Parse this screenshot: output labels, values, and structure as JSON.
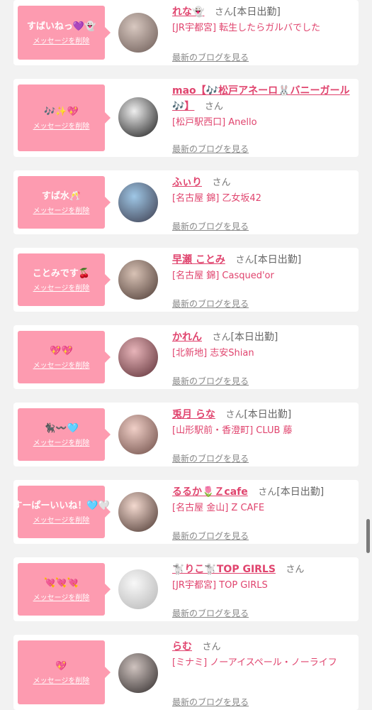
{
  "bubble_delete_label": "メッセージを削除",
  "san_label": "さん",
  "blog_link_label": "最新のブログを見る",
  "colors": {
    "accent_pink": "#fd9bb0",
    "link_pink": "#e0446e"
  },
  "items": [
    {
      "message": "すばいねっ💜👻",
      "name": "れな👻",
      "status": "[本日出勤]",
      "shop": "[JR宇都宮] 転生したらガルバでした",
      "avatar": {
        "bg1": "#d8c8c0",
        "bg2": "#6b5a55"
      }
    },
    {
      "message": "🎶✨💖",
      "name": "mao【🎶松戸アネーロ🐰バニーガール🎶】",
      "status": "",
      "shop": "[松戸駅西口] Anello",
      "avatar": {
        "bg1": "#eeeeee",
        "bg2": "#1a1a1a"
      }
    },
    {
      "message": "すば水🥂",
      "name": "ふぃり",
      "status": "",
      "shop": "[名古屋 錦] 乙女坂42",
      "avatar": {
        "bg1": "#9fc7e6",
        "bg2": "#3b3b4c"
      }
    },
    {
      "message": "ことみです🍒",
      "name": "早瀬 ことみ",
      "status": "[本日出勤]",
      "shop": "[名古屋 錦] Casqued'or",
      "avatar": {
        "bg1": "#d8c2b5",
        "bg2": "#4c3a34"
      }
    },
    {
      "message": "💖💖",
      "name": "かれん",
      "status": "[本日出勤]",
      "shop": "[北新地] 志安Shian",
      "avatar": {
        "bg1": "#e7b4b9",
        "bg2": "#5c2f35"
      }
    },
    {
      "message": "🐈‍⬛〰️🩵",
      "name": "兎月 らな",
      "status": "[本日出勤]",
      "shop": "[山形駅前・香澄町] CLUB 藤",
      "avatar": {
        "bg1": "#f0cfc7",
        "bg2": "#6c4b45"
      }
    },
    {
      "message": "すーぱーいいね！🩵🤍",
      "name": "るるか🌷Ｚcafe",
      "status": "[本日出勤]",
      "shop": "[名古屋 金山] Z CAFE",
      "avatar": {
        "bg1": "#f3d9cf",
        "bg2": "#4a3630"
      }
    },
    {
      "message": "💘💘💘",
      "name": "🐩りこ🐩TOP GIRLS",
      "status": "",
      "shop": "[JR宇都宮] TOP GIRLS",
      "avatar": {
        "bg1": "#f8f8f8",
        "bg2": "#b5b5b5"
      }
    },
    {
      "message": "💖",
      "name": "らむ",
      "status": "",
      "shop": "[ミナミ] ノーアイスペール・ノーライフ",
      "avatar": {
        "bg1": "#cfc3bf",
        "bg2": "#2f2a2a"
      }
    }
  ]
}
